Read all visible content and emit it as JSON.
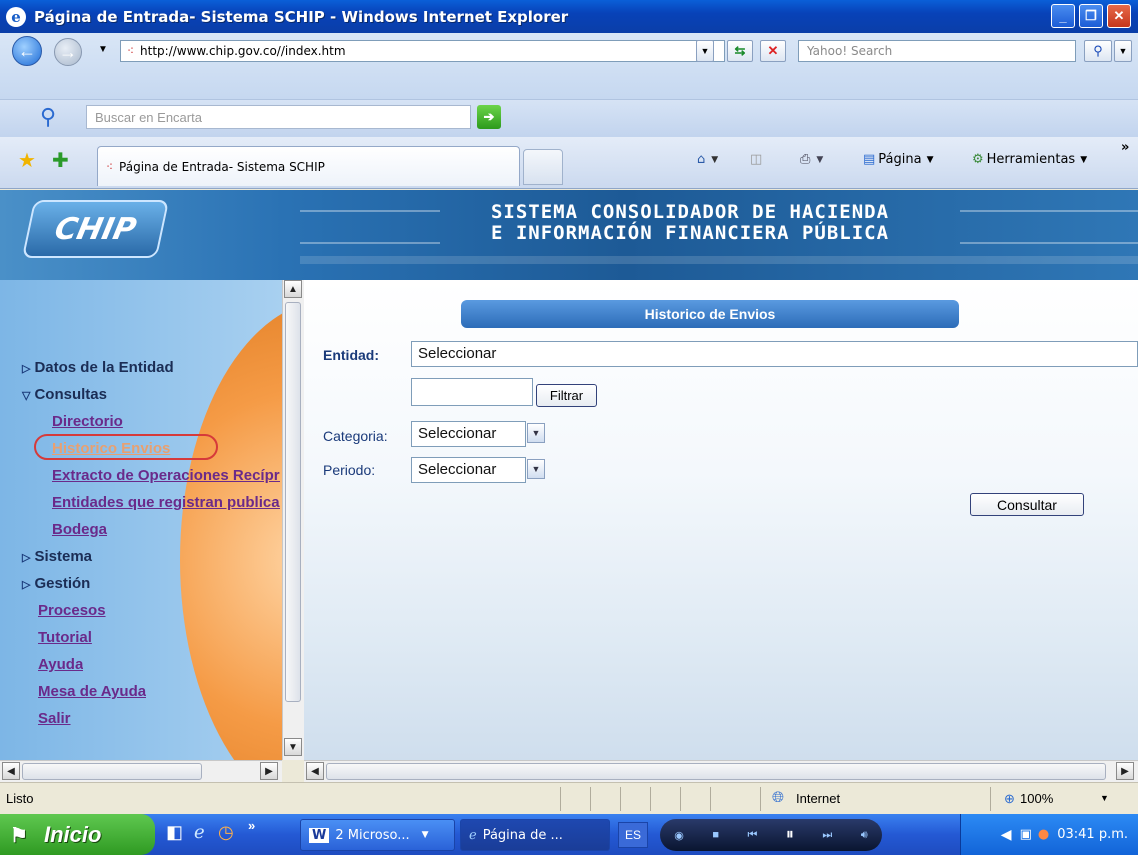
{
  "window": {
    "title": "Página de Entrada- Sistema SCHIP - Windows Internet Explorer"
  },
  "address": {
    "url": "http://www.chip.gov.co//index.htm",
    "search_placeholder": "Yahoo! Search"
  },
  "encarta": {
    "placeholder": "Buscar en Encarta"
  },
  "tab": {
    "title": "Página de Entrada- Sistema SCHIP"
  },
  "toolbar": {
    "page_label": "Página",
    "tools_label": "Herramientas"
  },
  "banner": {
    "logo": "CHIP",
    "line1": "SISTEMA CONSOLIDADOR DE HACIENDA",
    "line2": "E INFORMACIÓN FINANCIERA PÚBLICA"
  },
  "nav": {
    "datos": "Datos de la Entidad",
    "consultas": "Consultas",
    "sub": [
      "Directorio",
      "Historico Envios",
      "Extracto de Operaciones Recíprocas",
      "Entidades que registran publicaciones",
      "Bodega"
    ],
    "sistema": "Sistema",
    "gestion": "Gestión",
    "links": [
      "Procesos",
      "Tutorial",
      "Ayuda",
      "Mesa de Ayuda",
      "Salir"
    ]
  },
  "form": {
    "header": "Historico de Envios",
    "entidad_label": "Entidad:",
    "entidad_value": "Seleccionar",
    "filtrar": "Filtrar",
    "categoria_label": "Categoria:",
    "categoria_value": "Seleccionar",
    "periodo_label": "Periodo:",
    "periodo_value": "Seleccionar",
    "consultar": "Consultar"
  },
  "status": {
    "text": "Listo",
    "zone": "Internet",
    "zoom": "100%"
  },
  "taskbar": {
    "start": "Inicio",
    "task1": "2 Microso...",
    "task2": "Página de ...",
    "lang": "ES",
    "time": "03:41 p.m."
  }
}
